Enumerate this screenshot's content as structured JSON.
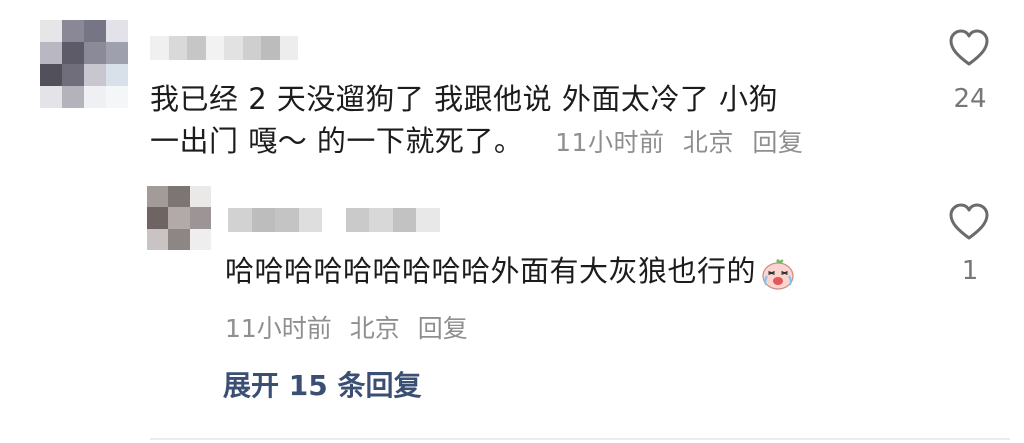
{
  "comment": {
    "text_line1": "我已经 2 天没遛狗了 我跟他说 外面太冷了 小狗",
    "text_line2": "一出门 嘎～ 的一下就死了。",
    "time": "11小时前",
    "location": "北京",
    "reply_label": "回复",
    "likes": "24"
  },
  "reply": {
    "text": "哈哈哈哈哈哈哈哈哈外面有大灰狼也行的",
    "emoji": "crying-laughing-sticker",
    "time": "11小时前",
    "location": "北京",
    "reply_label": "回复",
    "likes": "1"
  },
  "expand_label": "展开 15 条回复",
  "icons": {
    "like": "heart-outline-icon"
  },
  "colors": {
    "meta": "#8f8f8f",
    "expand_link": "#3b4f74",
    "text": "#1c1c1c"
  }
}
